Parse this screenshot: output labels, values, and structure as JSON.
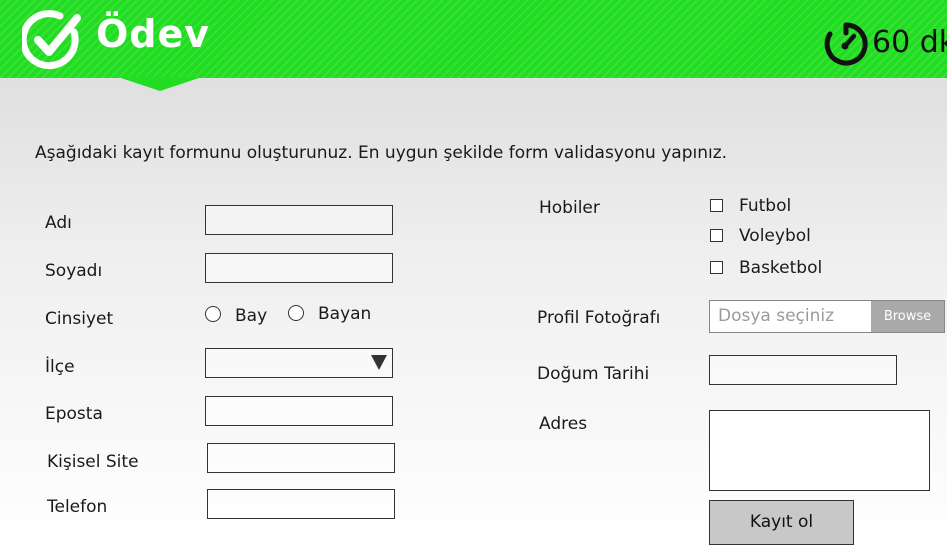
{
  "header": {
    "brand": "Ödev",
    "timer": "60 dk",
    "logo_icon": "check-circle-icon",
    "timer_icon": "stopwatch-icon",
    "accent_color": "#21dd21"
  },
  "instruction": "Aşağıdaki kayıt formunu oluşturunuz. En uygun şekilde form validasyonu yapınız.",
  "form_left": {
    "name_label": "Adı",
    "surname_label": "Soyadı",
    "gender_label": "Cinsiyet",
    "gender_options": [
      "Bay",
      "Bayan"
    ],
    "district_label": "İlçe",
    "email_label": "Eposta",
    "website_label": "Kişisel Site",
    "phone_label": "Telefon"
  },
  "form_right": {
    "hobbies_label": "Hobiler",
    "hobby_options": [
      "Futbol",
      "Voleybol",
      "Basketbol"
    ],
    "photo_label": "Profil Fotoğrafı",
    "photo_placeholder": "Dosya seçiniz",
    "browse_label": "Browse",
    "birthdate_label": "Doğum Tarihi",
    "address_label": "Adres",
    "submit_label": "Kayıt ol"
  }
}
